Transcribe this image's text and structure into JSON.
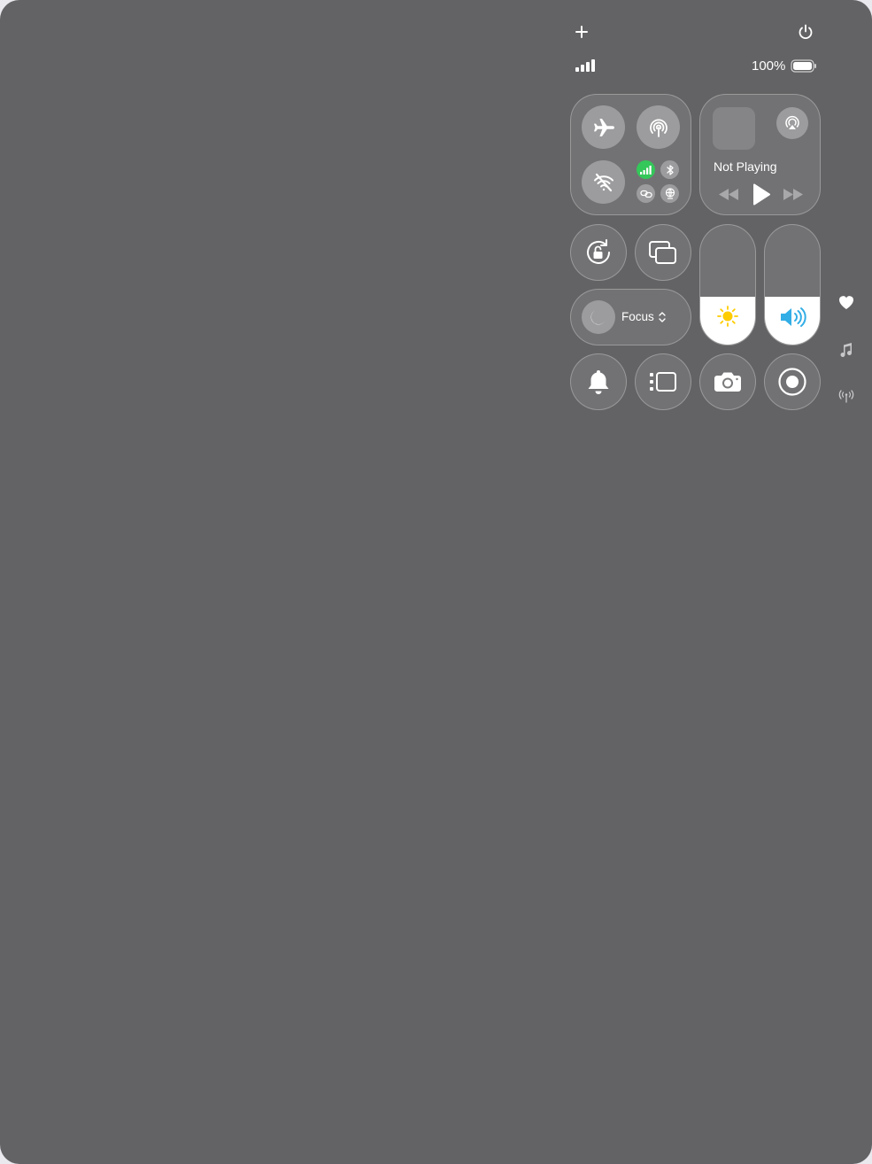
{
  "status": {
    "battery_text": "100%"
  },
  "media": {
    "now_playing": "Not Playing"
  },
  "focus": {
    "label": "Focus"
  },
  "sliders": {
    "brightness_level": 0.4,
    "volume_level": 0.4
  },
  "colors": {
    "background": "#636365",
    "cellular_active": "#34c759",
    "brightness_icon": "#ffcc00",
    "volume_icon": "#32ade6"
  },
  "icons": {
    "add": "plus-icon",
    "power": "power-icon",
    "signal": "signal-bars-icon",
    "battery": "battery-icon",
    "airplane": "airplane-icon",
    "airdrop": "airdrop-icon",
    "wifi_off": "wifi-off-icon",
    "cellular": "cellular-icon",
    "bluetooth": "bluetooth-icon",
    "link": "personal-hotspot-icon",
    "vpn": "vpn-icon",
    "airplay": "airplay-icon",
    "rewind": "rewind-icon",
    "play": "play-icon",
    "forward": "fast-forward-icon",
    "rotation_lock": "rotation-lock-icon",
    "screen_mirroring": "screen-mirroring-icon",
    "moon": "moon-icon",
    "sun": "sun-icon",
    "speaker": "speaker-icon",
    "bell": "bell-icon",
    "stage_manager": "stage-manager-icon",
    "camera": "camera-icon",
    "record": "screen-record-icon",
    "heart": "heart-icon",
    "music": "music-note-icon",
    "antenna": "antenna-icon"
  }
}
